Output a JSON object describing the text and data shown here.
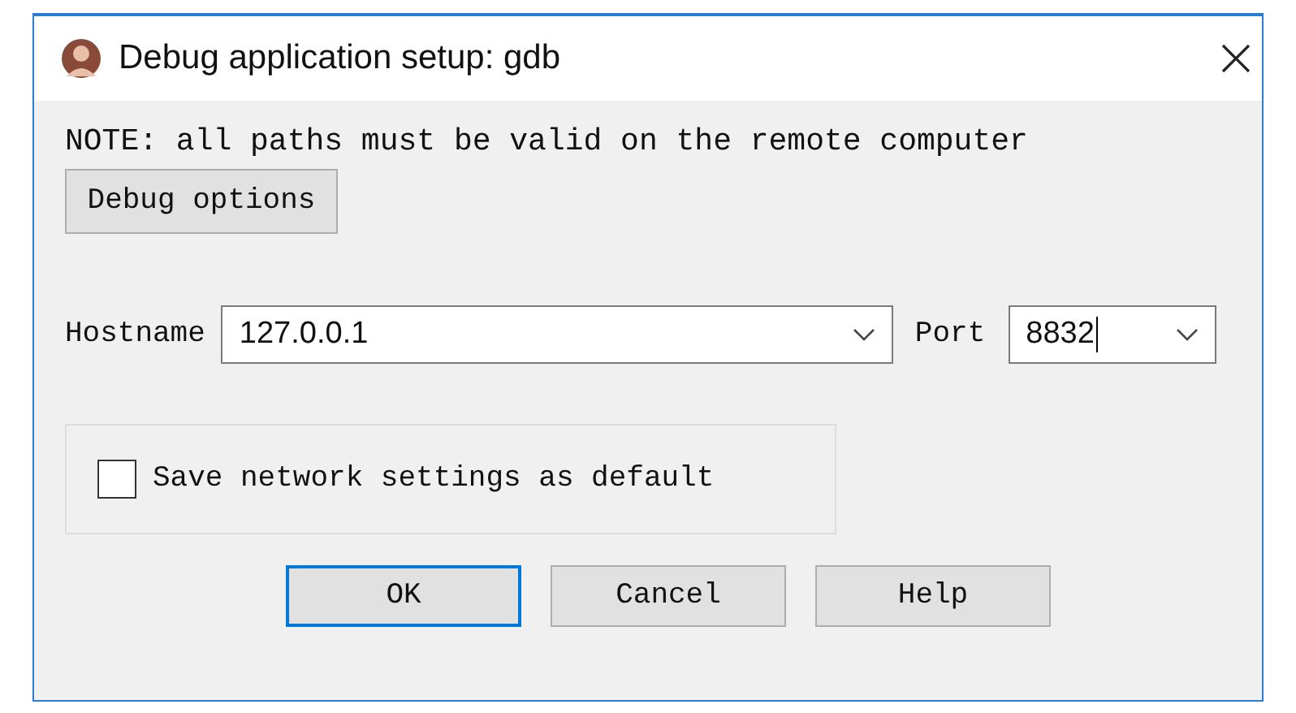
{
  "window": {
    "title": "Debug application setup: gdb"
  },
  "note": "NOTE: all paths must be valid on the remote computer",
  "debug_options_button": "Debug options",
  "hostname": {
    "label": "Hostname",
    "value": "127.0.0.1"
  },
  "port": {
    "label": "Port",
    "value": "8832"
  },
  "save_default": {
    "label": "Save network settings as default",
    "checked": false
  },
  "buttons": [
    {
      "label": "OK",
      "default": true
    },
    {
      "label": "Cancel",
      "default": false
    },
    {
      "label": "Help",
      "default": false
    }
  ]
}
